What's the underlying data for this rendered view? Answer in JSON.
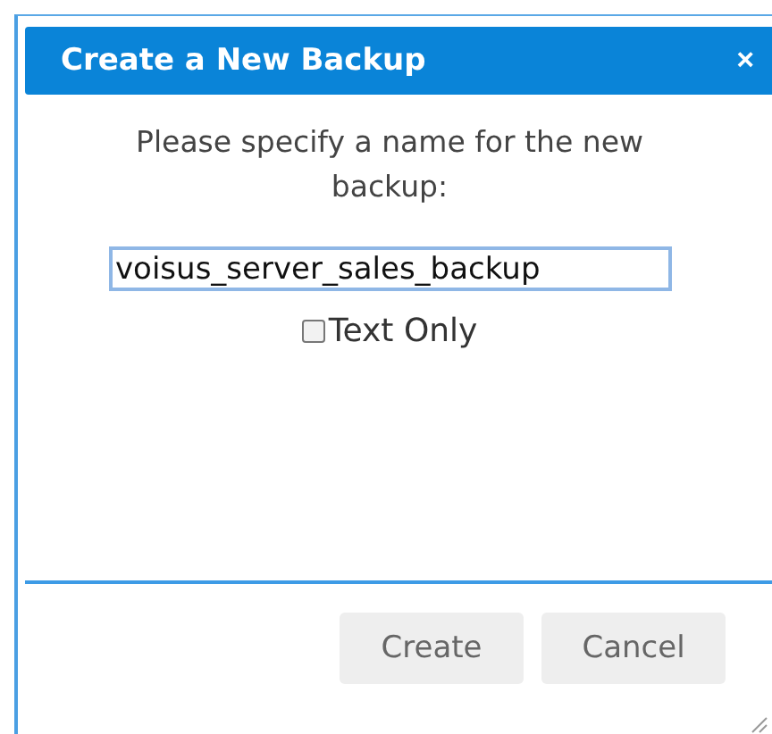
{
  "dialog": {
    "title": "Create a New Backup",
    "close": "×"
  },
  "message": "Please specify a name for the new backup:",
  "name_field": {
    "value": "voisus_server_sales_backup"
  },
  "text_only": {
    "label": "Text Only",
    "checked": false
  },
  "buttons": [
    "Create",
    "Cancel"
  ]
}
